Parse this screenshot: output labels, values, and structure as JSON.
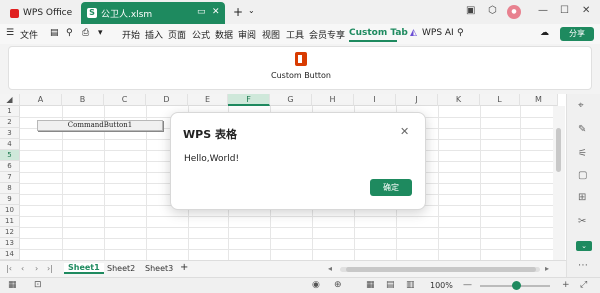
{
  "titlebar": {
    "app_tab": "WPS Office",
    "file_tab": "公卫人.xlsm",
    "new_tab_icon": "plus-icon",
    "avatar_text": "avatar"
  },
  "menubar": {
    "file_label": "文件",
    "items": [
      "开始",
      "插入",
      "页面",
      "公式",
      "数据",
      "审阅",
      "视图",
      "工具",
      "会员专享",
      "Custom Tab"
    ],
    "ai_label": "WPS AI",
    "share_label": "分享"
  },
  "ribbon": {
    "custom_button_label": "Custom Button"
  },
  "grid": {
    "columns": [
      "A",
      "B",
      "C",
      "D",
      "E",
      "F",
      "G",
      "H",
      "I",
      "J",
      "K",
      "L",
      "M"
    ],
    "selected_column": "F",
    "rows": [
      "1",
      "2",
      "3",
      "4",
      "5",
      "6",
      "7",
      "8",
      "9",
      "10",
      "11",
      "12",
      "13",
      "14"
    ],
    "selected_row": "5",
    "command_button_label": "CommandButton1"
  },
  "sheets": {
    "tabs": [
      "Sheet1",
      "Sheet2",
      "Sheet3"
    ],
    "active": "Sheet1"
  },
  "statusbar": {
    "zoom": "100%"
  },
  "dialog": {
    "title": "WPS 表格",
    "message": "Hello,World!",
    "ok_label": "确定"
  },
  "colors": {
    "accent": "#1e8a5f",
    "office_logo": "#d83b01",
    "brand_red": "#e02020"
  }
}
